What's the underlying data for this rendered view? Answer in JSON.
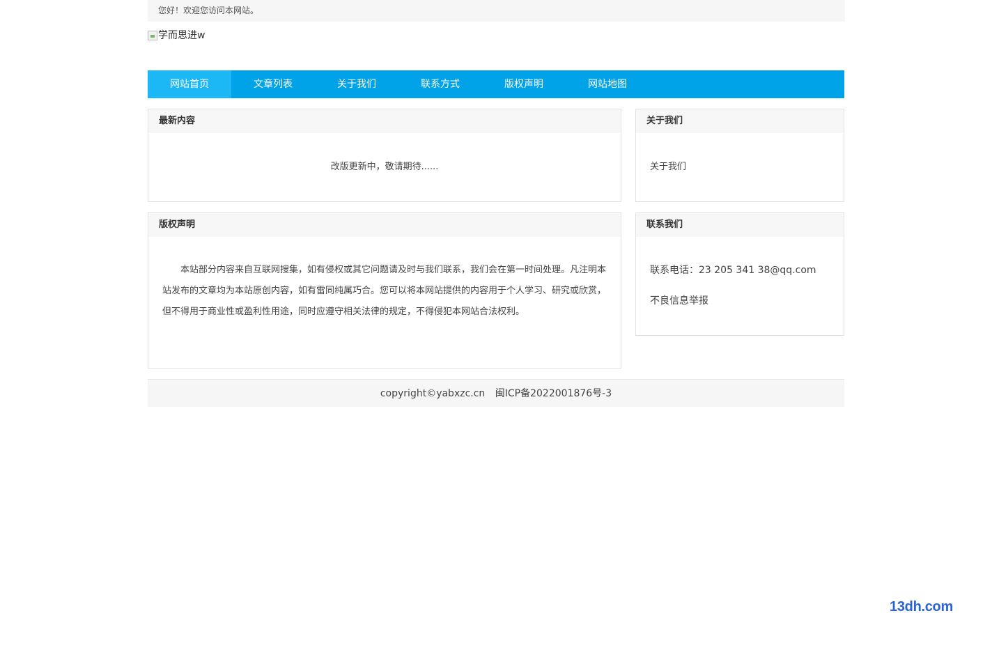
{
  "topbar": {
    "greeting": "您好！欢迎您访问本网站。"
  },
  "logo": {
    "alt_text": "学而思进w"
  },
  "nav": {
    "items": [
      {
        "label": "网站首页",
        "active": true
      },
      {
        "label": "文章列表"
      },
      {
        "label": "关于我们"
      },
      {
        "label": "联系方式"
      },
      {
        "label": "版权声明"
      },
      {
        "label": "网站地图"
      }
    ]
  },
  "latest": {
    "title": "最新内容",
    "body": "改版更新中，敬请期待......"
  },
  "about": {
    "title": "关于我们",
    "body": "关于我们"
  },
  "copyright_panel": {
    "title": "版权声明",
    "body": "本站部分内容来自互联网搜集，如有侵权或其它问题请及时与我们联系，我们会在第一时间处理。凡注明本站发布的文章均为本站原创内容，如有雷同纯属巧合。您可以将本网站提供的内容用于个人学习、研究或欣赏，但不得用于商业性或盈利性用途，同时应遵守相关法律的规定，不得侵犯本网站合法权利。"
  },
  "contact": {
    "title": "联系我们",
    "phone_line": "联系电话：23 205 341  38@qq.com",
    "report": "不良信息举报"
  },
  "footer": {
    "copyright": "copyright©yabxzc.cn",
    "icp": "闽ICP备2022001876号-3"
  },
  "watermark": "13dh.com",
  "colors": {
    "nav": "#00a3e8",
    "nav_active": "#1cb8f5",
    "watermark": "#2a63d6"
  }
}
